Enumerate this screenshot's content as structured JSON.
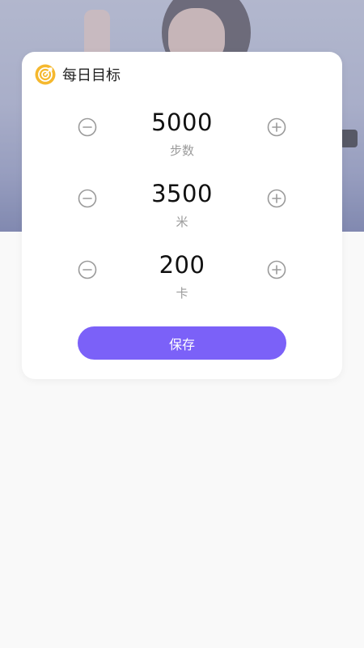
{
  "card": {
    "title": "每日目标",
    "icon": "target-icon"
  },
  "goals": [
    {
      "value": "5000",
      "unit": "步数"
    },
    {
      "value": "3500",
      "unit": "米"
    },
    {
      "value": "200",
      "unit": "卡"
    }
  ],
  "actions": {
    "save_label": "保存"
  },
  "colors": {
    "accent": "#7b61f8",
    "icon_yellow": "#f5b82e",
    "stepper_gray": "#9a9a9a"
  }
}
